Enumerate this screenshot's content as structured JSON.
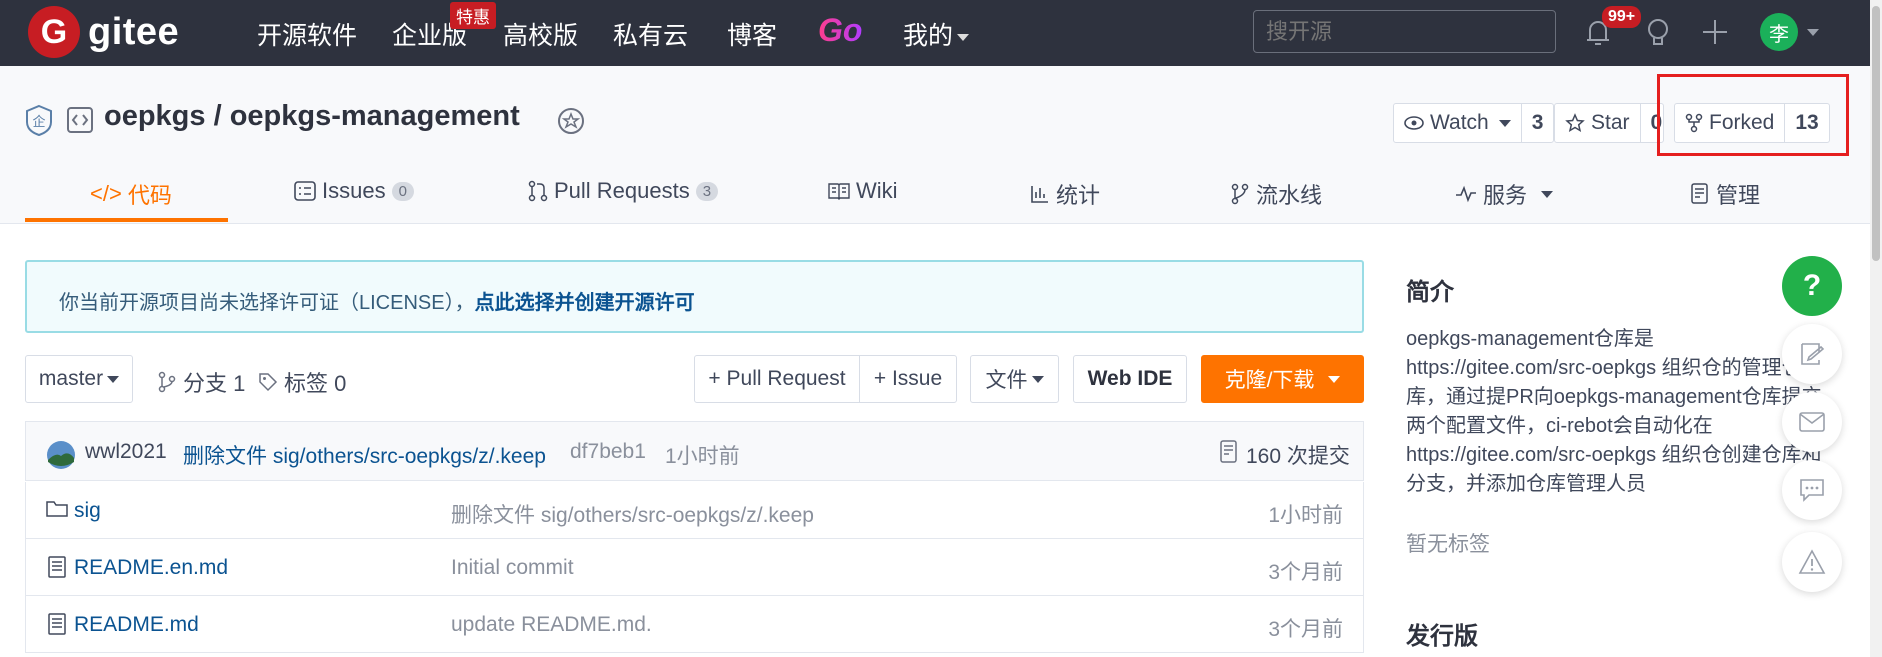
{
  "nav": {
    "logo_text": "gitee",
    "items": [
      "开源软件",
      "企业版",
      "高校版",
      "私有云",
      "博客"
    ],
    "go_label": "Go",
    "mine_label": "我的",
    "tehui_badge": "特惠",
    "search_placeholder": "搜开源",
    "notification_count": "99+",
    "avatar_letter": "李"
  },
  "repo": {
    "owner": "oepkgs",
    "separator": " / ",
    "name": "oepkgs-management",
    "watch_label": "Watch",
    "watch_count": "3",
    "star_label": "Star",
    "star_count": "0",
    "forked_label": "Forked",
    "forked_count": "13"
  },
  "tabs": [
    {
      "label": "代码"
    },
    {
      "label": "Issues",
      "count": "0"
    },
    {
      "label": "Pull Requests",
      "count": "3"
    },
    {
      "label": "Wiki"
    },
    {
      "label": "统计"
    },
    {
      "label": "流水线"
    },
    {
      "label": "服务"
    },
    {
      "label": "管理"
    }
  ],
  "license": {
    "text": "你当前开源项目尚未选择许可证（LICENSE），",
    "link": "点此选择并创建开源许可"
  },
  "toolbar": {
    "branch": "master",
    "branches": "分支 1",
    "tags": "标签 0",
    "pull_request": "+ Pull Request",
    "issue": "+ Issue",
    "file": "文件",
    "web_ide": "Web IDE",
    "clone": "克隆/下载"
  },
  "commit": {
    "author": "wwl2021",
    "message": "删除文件 sig/others/src-oepkgs/z/.keep",
    "hash": "df7beb1",
    "time": "1小时前",
    "total": "160 次提交"
  },
  "files": [
    {
      "name": "sig",
      "type": "folder",
      "message": "删除文件 sig/others/src-oepkgs/z/.keep",
      "time": "1小时前"
    },
    {
      "name": "README.en.md",
      "type": "file",
      "message": "Initial commit",
      "time": "3个月前"
    },
    {
      "name": "README.md",
      "type": "file",
      "message": "update README.md.",
      "time": "3个月前"
    }
  ],
  "sidebar": {
    "intro_title": "简介",
    "description": "oepkgs-management仓库是https://gitee.com/src-oepkgs 组织仓的管理仓库，通过提PR向oepkgs-management仓库提交两个配置文件，ci-rebot会自动化在https://gitee.com/src-oepkgs 组织仓创建仓库和分支，并添加仓库管理人员",
    "no_tags": "暂无标签",
    "releases_title": "发行版"
  },
  "colors": {
    "nav_bg": "#2e323e",
    "accent": "#fe7300",
    "brand_red": "#c71d23",
    "link": "#0b5391",
    "highlight_box": "#e51f1f"
  }
}
